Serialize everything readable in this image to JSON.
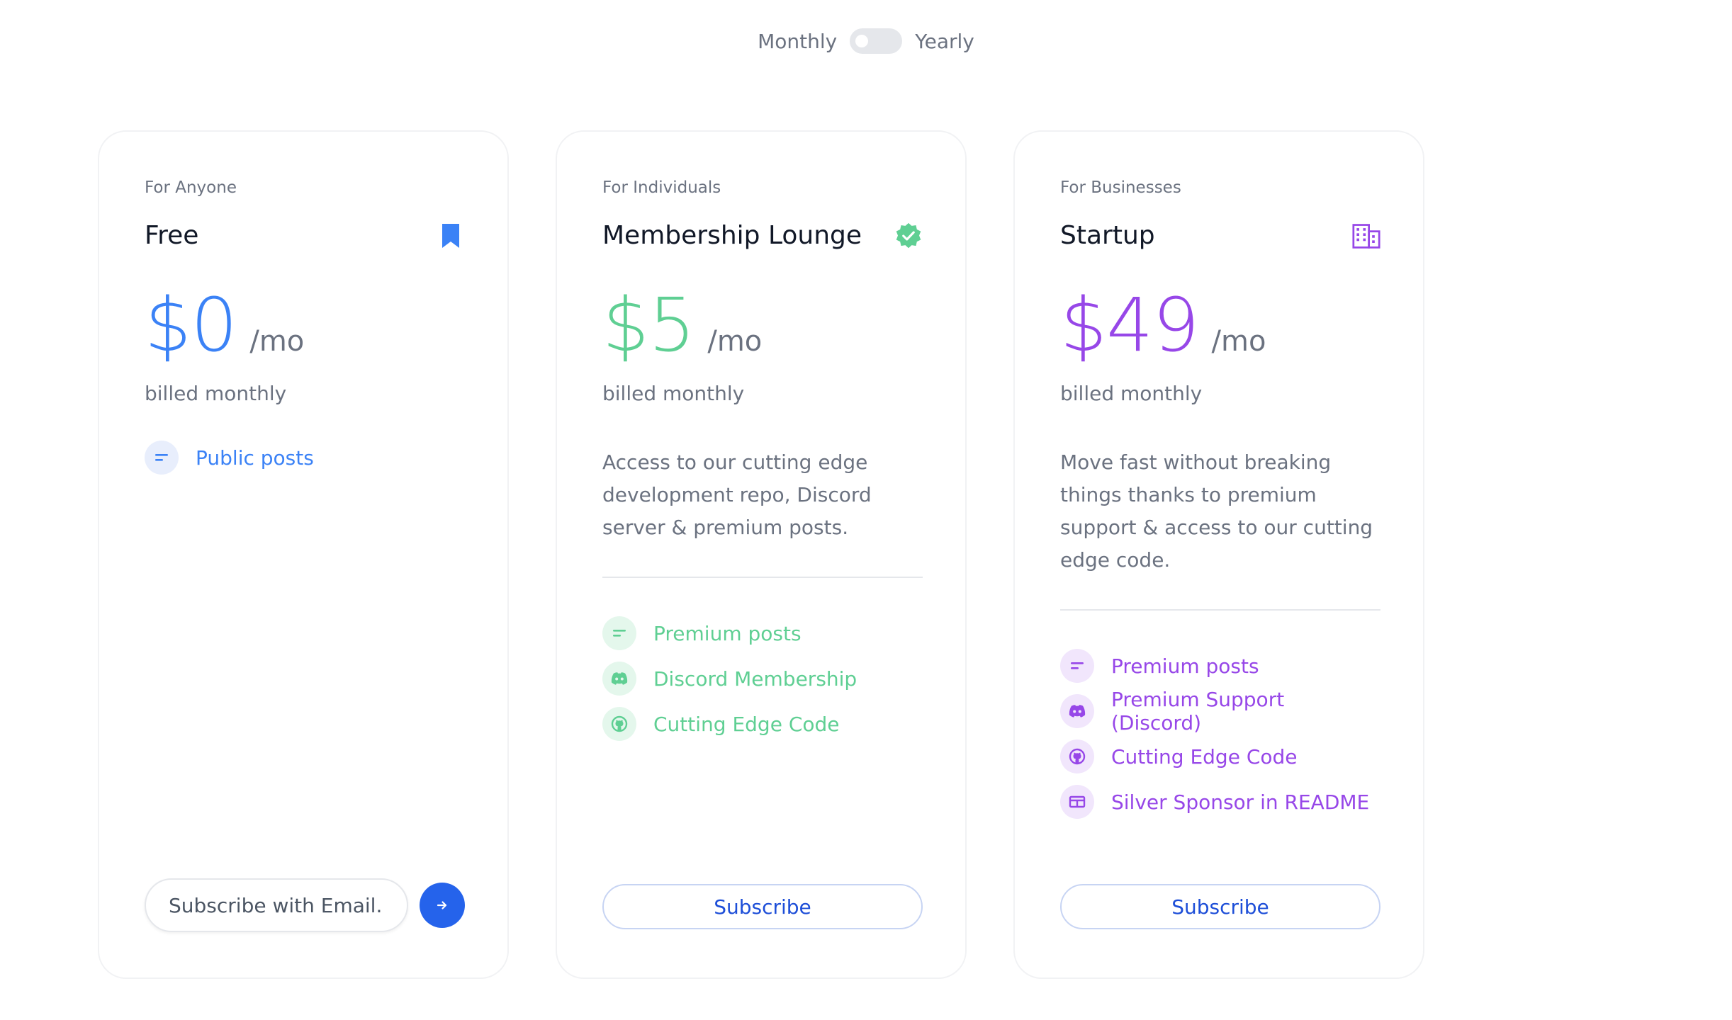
{
  "billing_toggle": {
    "monthly_label": "Monthly",
    "yearly_label": "Yearly",
    "selected": "Monthly"
  },
  "colors": {
    "blue": "#3b82f6",
    "green": "#5fcf93",
    "purple": "#9747e8",
    "primary_button": "#2563eb"
  },
  "plans": [
    {
      "eyebrow": "For Anyone",
      "title": "Free",
      "icon": "bookmark-icon",
      "price": "$0",
      "per": "/mo",
      "billed": "billed monthly",
      "description": "",
      "features": [
        {
          "label": "Public posts",
          "icon": "text-lines-icon"
        }
      ],
      "email_placeholder": "Subscribe with Email..."
    },
    {
      "eyebrow": "For Individuals",
      "title": "Membership Lounge",
      "icon": "verified-badge-icon",
      "price": "$5",
      "per": "/mo",
      "billed": "billed monthly",
      "description": "Access to our cutting edge development repo, Discord server & premium posts.",
      "features": [
        {
          "label": "Premium posts",
          "icon": "text-lines-icon"
        },
        {
          "label": "Discord Membership",
          "icon": "discord-icon"
        },
        {
          "label": "Cutting Edge Code",
          "icon": "github-icon"
        }
      ],
      "button_label": "Subscribe"
    },
    {
      "eyebrow": "For Businesses",
      "title": "Startup",
      "icon": "building-icon",
      "price": "$49",
      "per": "/mo",
      "billed": "billed monthly",
      "description": "Move fast without breaking things thanks to premium support & access to our cutting edge code.",
      "features": [
        {
          "label": "Premium posts",
          "icon": "text-lines-icon"
        },
        {
          "label": "Premium Support (Discord)",
          "icon": "discord-icon"
        },
        {
          "label": "Cutting Edge Code",
          "icon": "github-icon"
        },
        {
          "label": "Silver Sponsor in README",
          "icon": "sponsor-card-icon"
        }
      ],
      "button_label": "Subscribe"
    }
  ]
}
